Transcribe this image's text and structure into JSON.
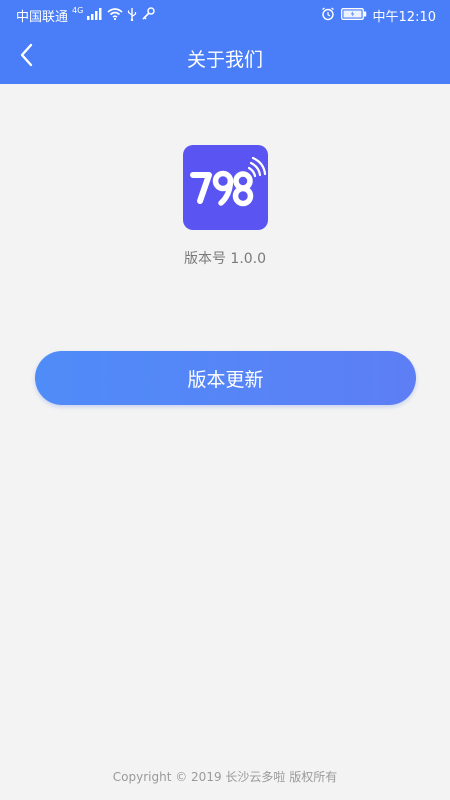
{
  "status_bar": {
    "carrier": "中国联通",
    "network_type": "4G",
    "time": "中午12:10",
    "icons": [
      "signal-icon",
      "wifi-icon",
      "usb-icon",
      "key-icon",
      "alarm-icon",
      "battery-icon"
    ]
  },
  "header": {
    "title": "关于我们",
    "back_icon": "chevron-left-icon"
  },
  "app": {
    "logo_text": "798",
    "logo_color": "#5a55f2",
    "version_label": "版本号",
    "version_number": "1.0.0"
  },
  "update_button": {
    "label": "版本更新"
  },
  "footer": {
    "copyright": "Copyright © 2019 长沙云多啦 版权所有"
  },
  "colors": {
    "primary": "#4a7ef8",
    "background": "#f3f3f3",
    "button_gradient_start": "#4f8cf8",
    "button_gradient_end": "#5d7ef5"
  }
}
